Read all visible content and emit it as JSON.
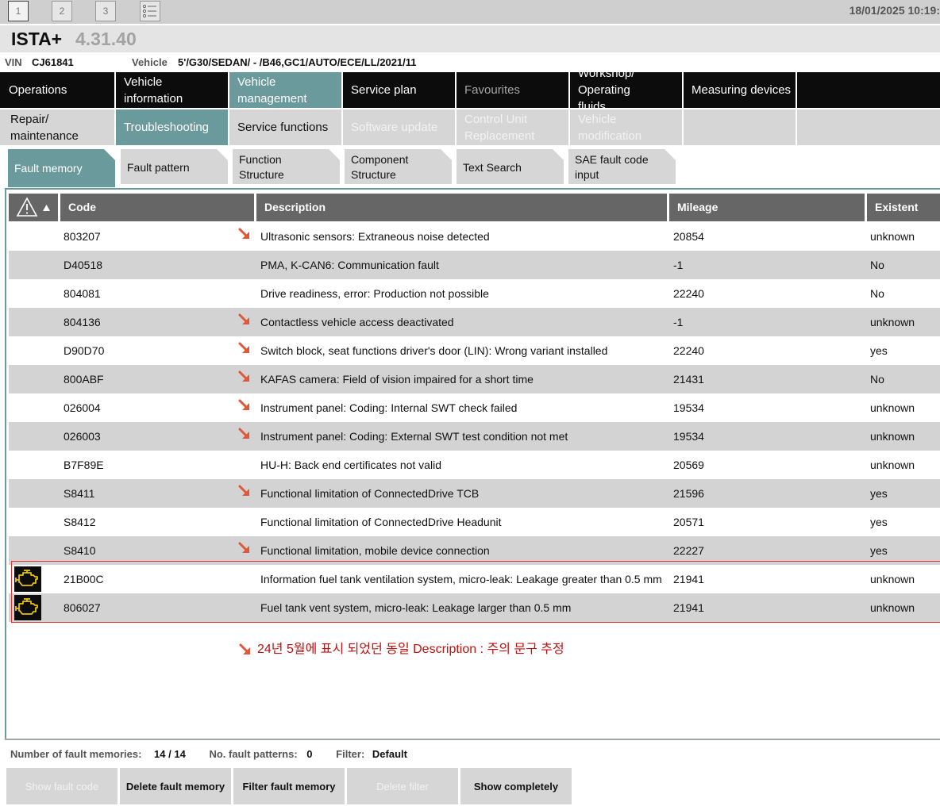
{
  "window": {
    "buttons": [
      "1",
      "2",
      "3"
    ],
    "datetime": "18/01/2025 10:19:"
  },
  "app": {
    "name": "ISTA+",
    "version": "4.31.40"
  },
  "vehicle": {
    "vin_label": "VIN",
    "vin": "CJ61841",
    "vehicle_label": "Vehicle",
    "vehicle": "5'/G30/SEDAN/ - /B46,GC1/AUTO/ECE/LL/2021/11"
  },
  "main_tabs": [
    {
      "label": "Operations"
    },
    {
      "label": "Vehicle information"
    },
    {
      "label": "Vehicle management"
    },
    {
      "label": "Service plan"
    },
    {
      "label": "Favourites"
    },
    {
      "label": "Workshop/ Operating fluids"
    },
    {
      "label": "Measuring devices"
    }
  ],
  "secondary_tabs": [
    {
      "label": "Repair/ maintenance"
    },
    {
      "label": "Troubleshooting"
    },
    {
      "label": "Service functions"
    },
    {
      "label": "Software update"
    },
    {
      "label": "Control Unit Replacement"
    },
    {
      "label": "Vehicle modification"
    }
  ],
  "sub_tabs": [
    {
      "label": "Fault memory"
    },
    {
      "label": "Fault pattern"
    },
    {
      "label": "Function Structure"
    },
    {
      "label": "Component Structure"
    },
    {
      "label": "Text Search"
    },
    {
      "label": "SAE fault code input"
    }
  ],
  "table": {
    "headers": {
      "code": "Code",
      "description": "Description",
      "mileage": "Mileage",
      "existent": "Existent"
    },
    "rows": [
      {
        "code": "803207",
        "description": "Ultrasonic sensors: Extraneous noise detected",
        "mileage": "20854",
        "existent": "unknown",
        "arrow": true
      },
      {
        "code": "D40518",
        "description": "PMA, K-CAN6: Communication fault",
        "mileage": "-1",
        "existent": "No"
      },
      {
        "code": "804081",
        "description": "Drive readiness, error: Production not possible",
        "mileage": "22240",
        "existent": "No"
      },
      {
        "code": "804136",
        "description": "Contactless vehicle access deactivated",
        "mileage": "-1",
        "existent": "unknown",
        "arrow": true
      },
      {
        "code": "D90D70",
        "description": "Switch block, seat functions driver's door (LIN): Wrong variant installed",
        "mileage": "22240",
        "existent": "yes",
        "arrow": true
      },
      {
        "code": "800ABF",
        "description": "KAFAS camera: Field of vision impaired for a short time",
        "mileage": "21431",
        "existent": "No",
        "arrow": true
      },
      {
        "code": "026004",
        "description": "Instrument panel: Coding: Internal SWT check failed",
        "mileage": "19534",
        "existent": "unknown",
        "arrow": true
      },
      {
        "code": "026003",
        "description": "Instrument panel: Coding: External SWT test condition not met",
        "mileage": "19534",
        "existent": "unknown",
        "arrow": true
      },
      {
        "code": "B7F89E",
        "description": "HU-H: Back end certificates not valid",
        "mileage": "20569",
        "existent": "unknown"
      },
      {
        "code": "S8411",
        "description": "Functional limitation of ConnectedDrive TCB",
        "mileage": "21596",
        "existent": "yes",
        "arrow": true
      },
      {
        "code": "S8412",
        "description": "Functional limitation of ConnectedDrive Headunit",
        "mileage": "20571",
        "existent": "yes"
      },
      {
        "code": "S8410",
        "description": "Functional limitation, mobile device connection",
        "mileage": "22227",
        "existent": "yes",
        "arrow": true
      },
      {
        "code": "21B00C",
        "description": "Information fuel tank ventilation system, micro-leak: Leakage greater than 0.5 mm",
        "mileage": "21941",
        "existent": "unknown",
        "engine_icon": true
      },
      {
        "code": "806027",
        "description": "Fuel tank vent system, micro-leak: Leakage larger than 0.5 mm",
        "mileage": "21941",
        "existent": "unknown",
        "engine_icon": true
      }
    ]
  },
  "annotation": "24년 5월에 표시 되었던 동일  Description : 주의 문구 추정",
  "status": {
    "fault_memories_label": "Number of fault memories:",
    "fault_memories_value": "14 / 14",
    "patterns_label": "No. fault patterns:",
    "patterns_value": "0",
    "filter_label": "Filter:",
    "filter_value": "Default"
  },
  "buttons": {
    "show_fault_code": "Show fault code",
    "delete_fault_memory": "Delete fault memory",
    "filter_fault_memory": "Filter fault memory",
    "delete_filter": "Delete filter",
    "show_completely": "Show completely"
  },
  "colors": {
    "accent": "#6a9a9c",
    "arrow": "#e0573a",
    "highlight": "#e03030",
    "engine_icon": "#e8c400"
  }
}
